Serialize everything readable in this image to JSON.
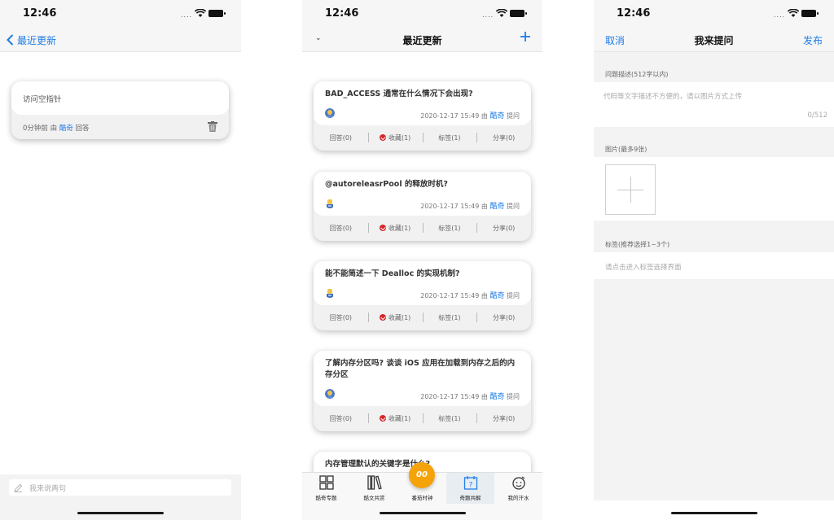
{
  "status": {
    "time": "12:46"
  },
  "panel1": {
    "back_label": "最近更新",
    "card": {
      "question": "访问空指针",
      "meta_prefix": "0分钟前 由 ",
      "author": "酷奇",
      "meta_suffix": " 回答"
    },
    "input_placeholder": "我来说两句"
  },
  "panel2": {
    "title": "最近更新",
    "cards": [
      {
        "title": "BAD_ACCESS 通常在什么情况下会出现?",
        "date": "2020-12-17 15:49 由 ",
        "author": "酷奇",
        "suffix": " 提问",
        "answers": "回答(0)",
        "favorites": "收藏(1)",
        "tags": "标签(1)",
        "share": "分享(0)"
      },
      {
        "title": "@autoreleasrPool 的释放时机?",
        "date": "2020-12-17 15:49 由 ",
        "author": "酷奇",
        "suffix": " 提问",
        "answers": "回答(0)",
        "favorites": "收藏(1)",
        "tags": "标签(1)",
        "share": "分享(0)"
      },
      {
        "title": "能不能简述一下 Dealloc 的实现机制?",
        "date": "2020-12-17 15:49 由 ",
        "author": "酷奇",
        "suffix": " 提问",
        "answers": "回答(0)",
        "favorites": "收藏(1)",
        "tags": "标签(1)",
        "share": "分享(0)"
      },
      {
        "title": "了解内存分区吗? 谈谈 iOS 应用在加载到内存之后的内存分区",
        "date": "2020-12-17 15:49 由 ",
        "author": "酷奇",
        "suffix": " 提问",
        "answers": "回答(0)",
        "favorites": "收藏(1)",
        "tags": "标签(1)",
        "share": "分享(0)"
      },
      {
        "title": "内存管理默认的关键字是什么?"
      }
    ],
    "tabs": [
      {
        "label": "酷奇专题",
        "icon": "grid-icon"
      },
      {
        "label": "酷文共赏",
        "icon": "books-icon"
      },
      {
        "label": "番茄时钟",
        "icon": "clock-icon",
        "badge": "00"
      },
      {
        "label": "奇题共解",
        "icon": "calendar-question-icon"
      },
      {
        "label": "我的汗水",
        "icon": "smiley-icon"
      }
    ]
  },
  "panel3": {
    "cancel": "取消",
    "title": "我来提问",
    "publish": "发布",
    "desc_label": "问题描述(512字以内)",
    "desc_placeholder": "代码等文字描述不方便的，请以图片方式上传",
    "counter": "0/512",
    "images_label": "图片(最多9张)",
    "tags_label": "标签(推荐选择1~3个)",
    "tags_placeholder": "请点击进入标签选择界面"
  },
  "colors": {
    "accent": "#1e7ce6",
    "fab": "#f5a30b",
    "favorite": "#d8262b"
  }
}
